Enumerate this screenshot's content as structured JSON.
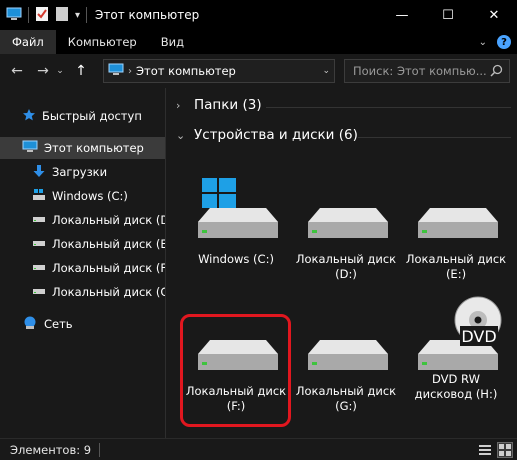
{
  "window": {
    "title": "Этот компьютер",
    "minimize": "—",
    "maximize": "☐",
    "close": "✕"
  },
  "ribbon": {
    "tabs": [
      "Файл",
      "Компьютер",
      "Вид"
    ],
    "active_tab": "Файл",
    "accent": "#2b2b2b"
  },
  "address_bar": {
    "path": "Этот компьютер",
    "search_placeholder": "Поиск: Этот компью..."
  },
  "nav_pane": {
    "quick_access": "Быстрый доступ",
    "this_pc": "Этот компьютер",
    "children": [
      {
        "label": "Загрузки",
        "icon": "download-icon"
      },
      {
        "label": "Windows (C:)",
        "icon": "windows-drive-icon"
      },
      {
        "label": "Локальный диск (D:)",
        "icon": "drive-icon"
      },
      {
        "label": "Локальный диск (E:)",
        "icon": "drive-icon"
      },
      {
        "label": "Локальный диск (F:)",
        "icon": "drive-icon"
      },
      {
        "label": "Локальный диск (G:)",
        "icon": "drive-icon"
      }
    ],
    "network": "Сеть"
  },
  "content": {
    "folders_group": "Папки (3)",
    "devices_group": "Устройства и диски (6)",
    "drives": [
      {
        "line1": "Windows (C:)",
        "line2": "",
        "type": "windows"
      },
      {
        "line1": "Локальный диск",
        "line2": "(D:)",
        "type": "hdd"
      },
      {
        "line1": "Локальный диск",
        "line2": "(E:)",
        "type": "hdd"
      },
      {
        "line1": "Локальный диск",
        "line2": "(F:)",
        "type": "hdd",
        "highlighted": true
      },
      {
        "line1": "Локальный диск",
        "line2": "(G:)",
        "type": "hdd"
      },
      {
        "line1": "DVD RW",
        "line2": "дисковод (H:)",
        "type": "dvd",
        "badge": "DVD"
      }
    ],
    "highlight_color": "#e1171f"
  },
  "status_bar": {
    "items_count": "Элементов: 9"
  }
}
